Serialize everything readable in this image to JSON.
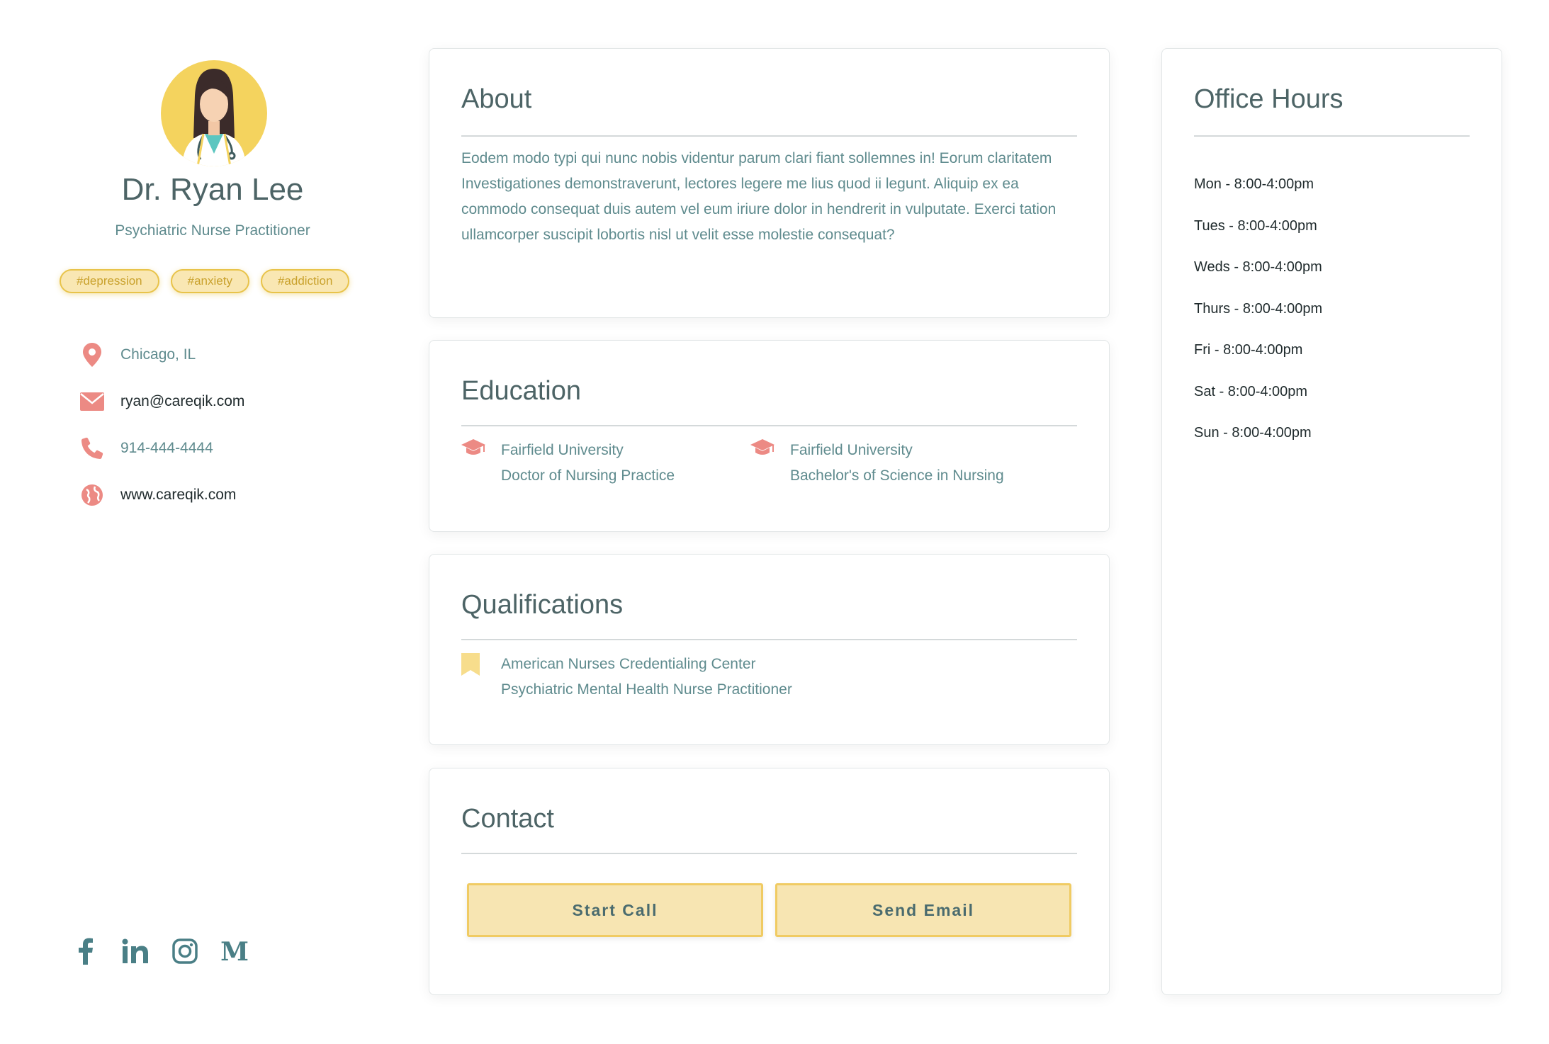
{
  "profile": {
    "name": "Dr. Ryan Lee",
    "title": "Psychiatric Nurse Practitioner",
    "tags": [
      "#depression",
      "#anxiety",
      "#addiction"
    ],
    "location": "Chicago, IL",
    "email": "ryan@careqik.com",
    "phone": "914-444-4444",
    "website": "www.careqik.com"
  },
  "socials": [
    "facebook-icon",
    "linkedin-icon",
    "instagram-icon",
    "medium-icon"
  ],
  "about": {
    "heading": "About",
    "text": "Eodem modo typi qui nunc nobis videntur parum clari fiant sollemnes in! Eorum claritatem Investigationes demonstraverunt, lectores legere me lius quod ii legunt. Aliquip ex ea commodo consequat duis autem vel eum iriure dolor in hendrerit in vulputate. Exerci tation ullamcorper suscipit lobortis nisl ut velit esse molestie consequat?"
  },
  "education": {
    "heading": "Education",
    "items": [
      {
        "school": "Fairfield University",
        "degree": "Doctor of Nursing Practice"
      },
      {
        "school": "Fairfield University",
        "degree": "Bachelor's of Science in Nursing"
      }
    ]
  },
  "qualifications": {
    "heading": "Qualifications",
    "items": [
      {
        "org": "American Nurses Credentialing Center",
        "cert": "Psychiatric Mental Health Nurse Practitioner"
      }
    ]
  },
  "contact": {
    "heading": "Contact",
    "start_call": "Start Call",
    "send_email": "Send Email"
  },
  "office_hours": {
    "heading": "Office Hours",
    "hours": [
      "Mon - 8:00-4:00pm",
      "Tues - 8:00-4:00pm",
      "Weds - 8:00-4:00pm",
      "Thurs - 8:00-4:00pm",
      "Fri - 8:00-4:00pm",
      "Sat - 8:00-4:00pm",
      "Sun - 8:00-4:00pm"
    ]
  },
  "colors": {
    "accent_yellow": "#f4d35e",
    "icon_coral": "#ec8a84",
    "heading_slate": "#4d6466",
    "text_teal": "#5f8b8e"
  }
}
